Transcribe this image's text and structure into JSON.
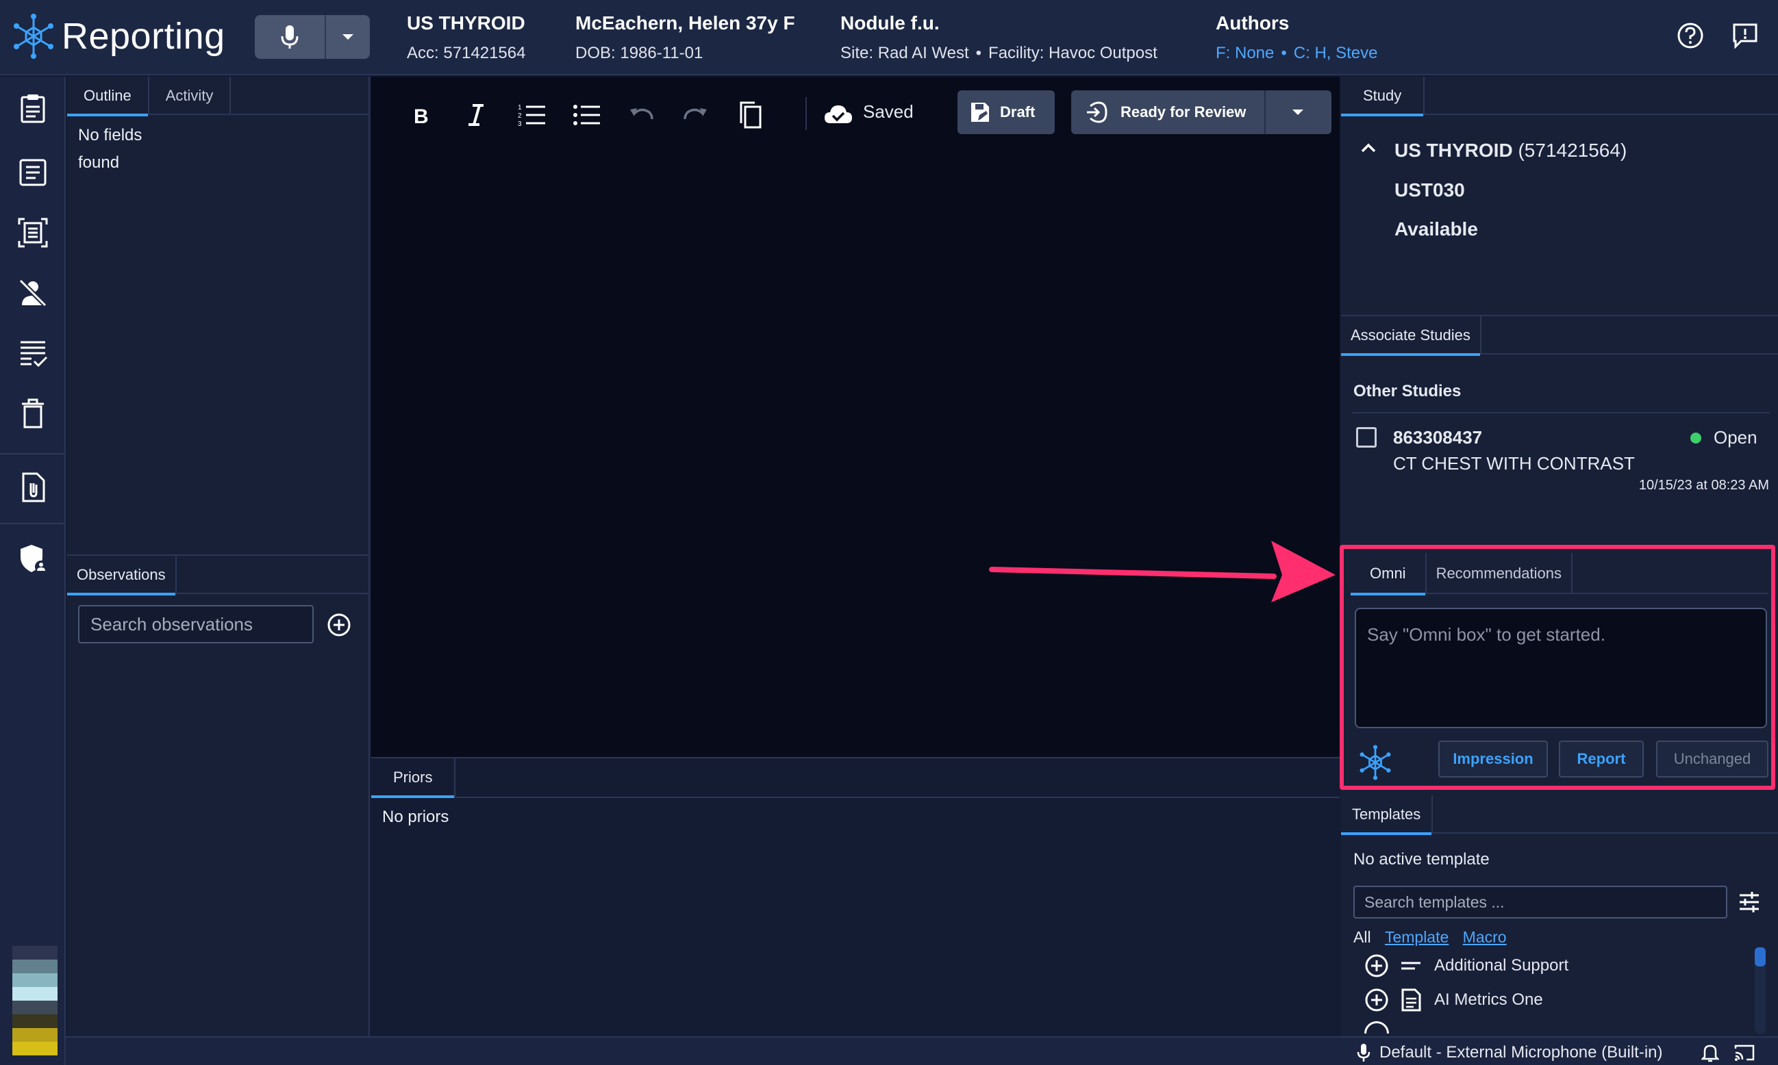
{
  "app": {
    "title": "Reporting"
  },
  "header": {
    "study": {
      "title": "US THYROID",
      "sub": "Acc: 571421564"
    },
    "patient": {
      "title": "McEachern, Helen 37y F",
      "sub": "DOB: 1986-11-01"
    },
    "reason": {
      "title": "Nodule f.u.",
      "site": "Site: Rad AI West",
      "facility": "Facility: Havoc Outpost"
    },
    "authors": {
      "title": "Authors",
      "first": "F: None",
      "coauthors": "C: H, Steve"
    }
  },
  "outline": {
    "tabs": [
      "Outline",
      "Activity"
    ],
    "empty_line1": "No fields",
    "empty_line2": "found"
  },
  "observations": {
    "tab": "Observations",
    "search_placeholder": "Search observations"
  },
  "editor": {
    "saved_label": "Saved",
    "draft_label": "Draft",
    "review_label": "Ready for Review"
  },
  "priors": {
    "tab": "Priors",
    "empty": "No priors"
  },
  "study": {
    "tab": "Study",
    "name": "US THYROID",
    "accession": "(571421564)",
    "code": "UST030",
    "status": "Available"
  },
  "associate": {
    "tab": "Associate Studies",
    "section_title": "Other Studies",
    "items": [
      {
        "accession": "863308437",
        "status": "Open",
        "description": "CT CHEST WITH CONTRAST",
        "date": "10/15/23 at 08:23 AM"
      }
    ]
  },
  "omni": {
    "tabs": [
      "Omni",
      "Recommendations"
    ],
    "placeholder": "Say \"Omni box\" to get started.",
    "buttons": {
      "impression": "Impression",
      "report": "Report",
      "unchanged": "Unchanged"
    }
  },
  "templates": {
    "tab": "Templates",
    "empty": "No active template",
    "search_placeholder": "Search templates ...",
    "filters": {
      "all": "All",
      "template": "Template",
      "macro": "Macro"
    },
    "items": [
      {
        "label": "Additional Support",
        "icon": "lines-icon"
      },
      {
        "label": "AI Metrics One",
        "icon": "document-icon"
      }
    ]
  },
  "statusbar": {
    "device": "Default - External Microphone (Built-in)"
  },
  "colors": {
    "accent": "#3aa3ff",
    "link": "#4ea8ff",
    "open_status": "#3ecf6a",
    "annotation": "#ff2e6e",
    "editor_bg": "#070b1a"
  }
}
